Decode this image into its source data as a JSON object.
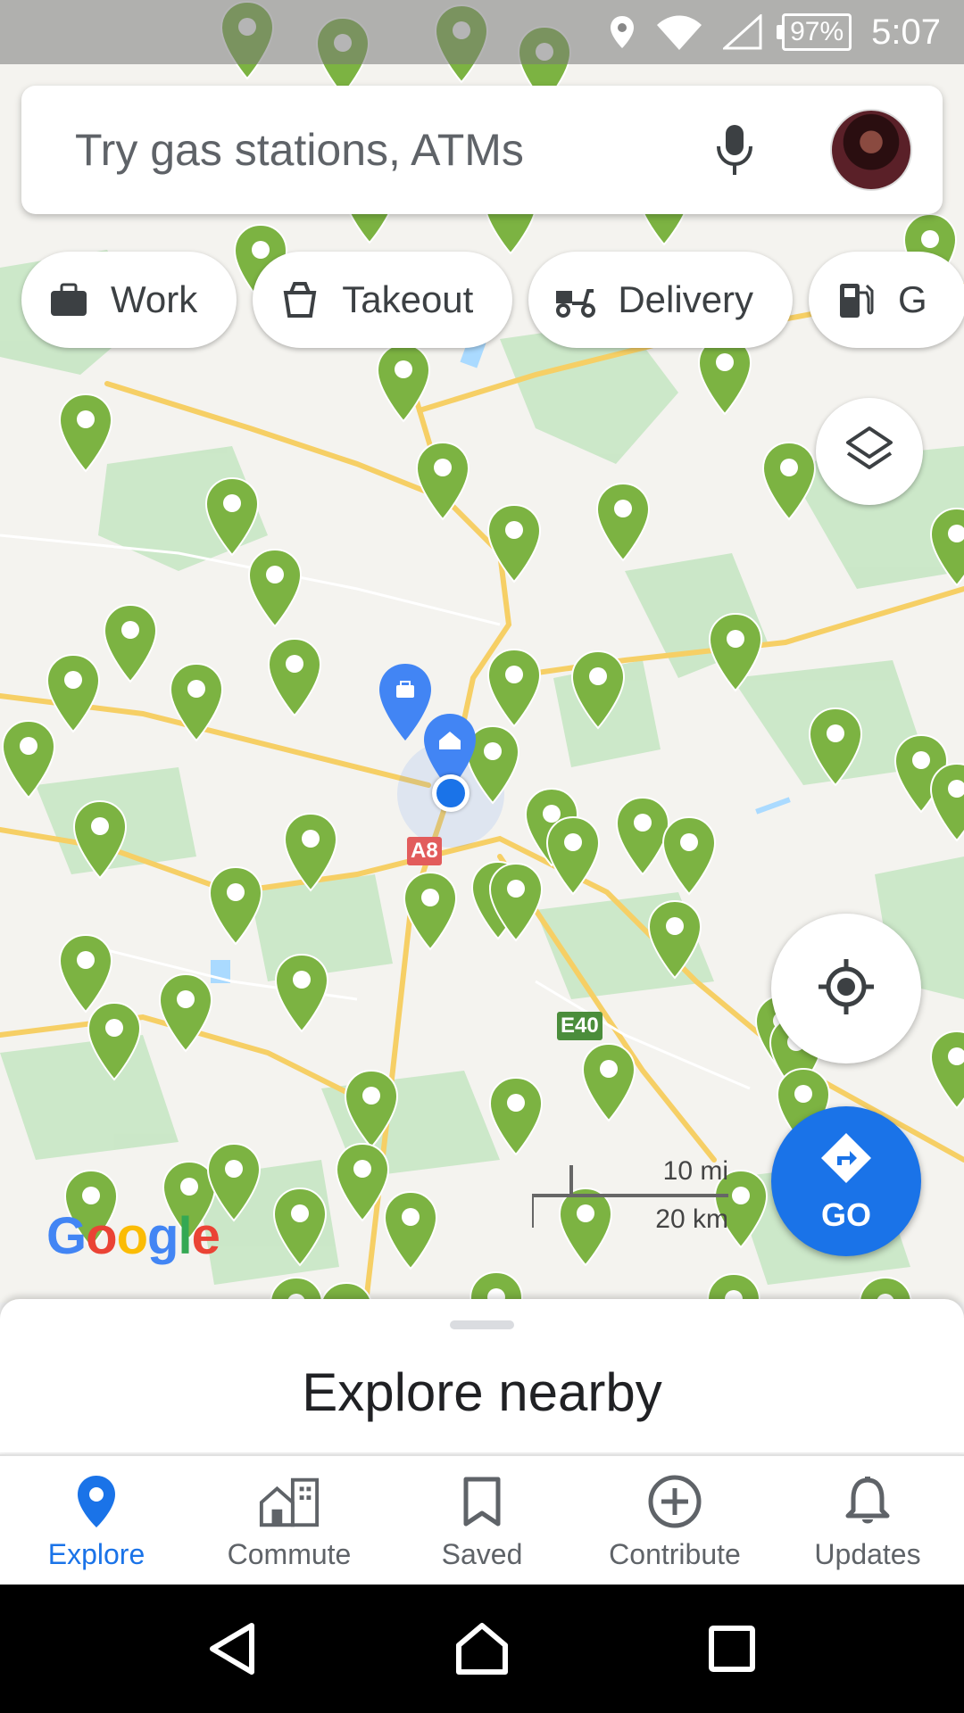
{
  "status_bar": {
    "battery": "97%",
    "time": "5:07"
  },
  "search": {
    "placeholder": "Try gas stations, ATMs",
    "icons": [
      "mic-icon",
      "avatar"
    ]
  },
  "chips": [
    {
      "label": "Work",
      "icon": "briefcase-icon"
    },
    {
      "label": "Takeout",
      "icon": "takeout-icon"
    },
    {
      "label": "Delivery",
      "icon": "scooter-icon"
    },
    {
      "label": "G",
      "icon": "gas-station-icon"
    }
  ],
  "map": {
    "road_labels": [
      "A8",
      "E40"
    ],
    "scale": {
      "miles": "10 mi",
      "km": "20 km"
    },
    "logo": "Google",
    "go_label": "GO",
    "pin_color": "#7cb342"
  },
  "sheet": {
    "title": "Explore nearby"
  },
  "bottom_nav": [
    {
      "label": "Explore",
      "icon": "explore-pin-icon",
      "active": true
    },
    {
      "label": "Commute",
      "icon": "commute-icon",
      "active": false
    },
    {
      "label": "Saved",
      "icon": "bookmark-icon",
      "active": false
    },
    {
      "label": "Contribute",
      "icon": "plus-circle-icon",
      "active": false
    },
    {
      "label": "Updates",
      "icon": "bell-icon",
      "active": false
    }
  ],
  "colors": {
    "accent": "#1a73e8",
    "pin": "#7cb342",
    "go": "#1a73e8"
  }
}
